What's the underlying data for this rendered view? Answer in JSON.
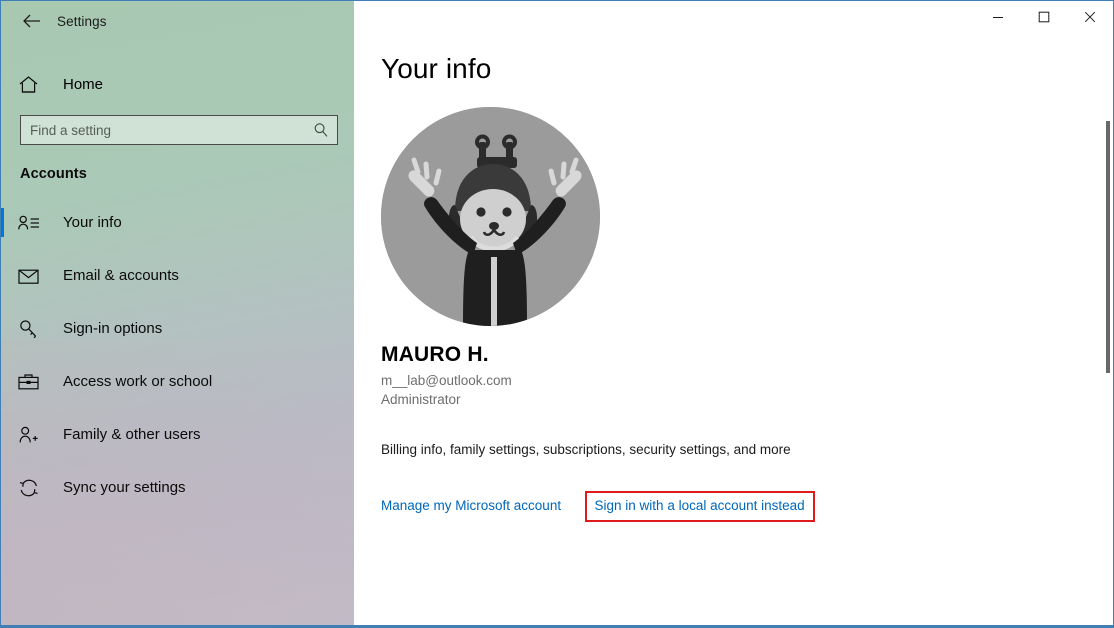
{
  "window": {
    "app_title": "Settings",
    "back_icon": "back-arrow-icon",
    "controls": {
      "minimize": "minimize-icon",
      "maximize": "maximize-icon",
      "close": "close-icon"
    },
    "border_color": "#3f7fb5"
  },
  "sidebar": {
    "home": {
      "label": "Home",
      "icon": "home-icon"
    },
    "search": {
      "placeholder": "Find a setting",
      "value": "",
      "icon": "search-icon"
    },
    "category": "Accounts",
    "accent_color": "#0078d7",
    "items": [
      {
        "label": "Your info",
        "icon": "user-details-icon",
        "selected": true
      },
      {
        "label": "Email & accounts",
        "icon": "envelope-icon",
        "selected": false
      },
      {
        "label": "Sign-in options",
        "icon": "key-icon",
        "selected": false
      },
      {
        "label": "Access work or school",
        "icon": "briefcase-icon",
        "selected": false
      },
      {
        "label": "Family & other users",
        "icon": "add-user-icon",
        "selected": false
      },
      {
        "label": "Sync your settings",
        "icon": "sync-icon",
        "selected": false
      }
    ]
  },
  "main": {
    "page_title": "Your info",
    "avatar": {
      "icon": "profile-avatar-image",
      "background_color": "#9b9b9b"
    },
    "account": {
      "name": "MAURO H.",
      "email": "m__lab@outlook.com",
      "role": "Administrator"
    },
    "billing_text": "Billing info, family settings, subscriptions, security settings, and more",
    "manage_link": "Manage my Microsoft account",
    "local_account_link": "Sign in with a local account instead",
    "highlight_color": "#e01b1b",
    "link_color": "#0067b8"
  }
}
